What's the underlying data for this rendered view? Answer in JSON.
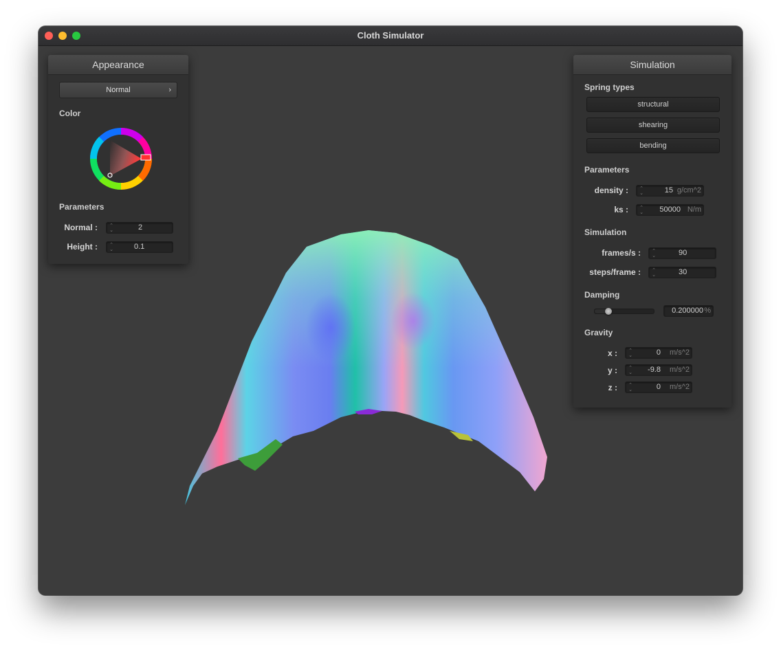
{
  "window": {
    "title": "Cloth Simulator"
  },
  "appearance": {
    "title": "Appearance",
    "shader_select": "Normal",
    "color_label": "Color",
    "parameters_label": "Parameters",
    "normal_label": "Normal :",
    "normal_value": "2",
    "height_label": "Height :",
    "height_value": "0.1"
  },
  "simulation": {
    "title": "Simulation",
    "spring_types_label": "Spring types",
    "spring_types": [
      "structural",
      "shearing",
      "bending"
    ],
    "parameters_label": "Parameters",
    "density_label": "density :",
    "density_value": "15",
    "density_unit": "g/cm^2",
    "ks_label": "ks :",
    "ks_value": "50000",
    "ks_unit": "N/m",
    "simulation_label": "Simulation",
    "fps_label": "frames/s :",
    "fps_value": "90",
    "steps_label": "steps/frame :",
    "steps_value": "30",
    "damping_label": "Damping",
    "damping_value": "0.200000",
    "damping_unit": "%",
    "damping_slider_fraction": 0.2,
    "gravity_label": "Gravity",
    "gx_label": "x :",
    "gx_value": "0",
    "gy_label": "y :",
    "gy_value": "-9.8",
    "gz_label": "z :",
    "gz_value": "0",
    "gravity_unit": "m/s^2"
  },
  "colors": {
    "selected_color": "#ff0000",
    "panel_bg": "#313131",
    "viewport_bg": "#3c3c3c"
  }
}
